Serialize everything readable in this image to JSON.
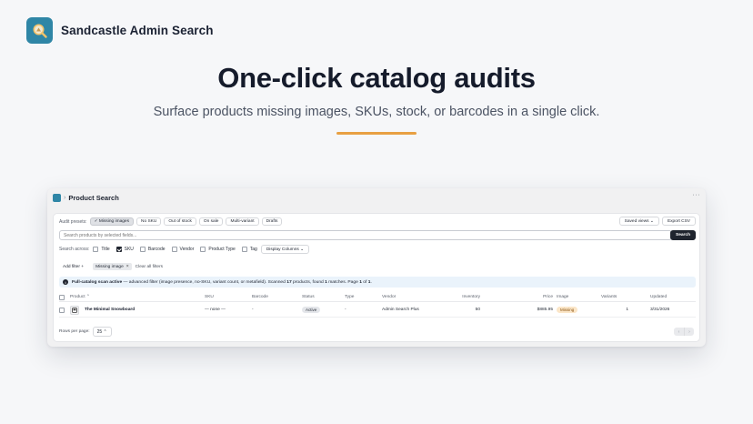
{
  "brand": {
    "name": "Sandcastle Admin Search",
    "logo_icon": "magnifier-icon",
    "logo_color": "#2f86a6"
  },
  "hero": {
    "title": "One-click catalog audits",
    "subtitle": "Surface products missing images, SKUs, stock, or barcodes in a single click.",
    "accent": "#e8a043"
  },
  "app": {
    "breadcrumb_sep": "›",
    "title": "Product Search",
    "more": "···",
    "audit": {
      "label": "Audit presets:",
      "presets": [
        {
          "label": "✓ Missing images",
          "active": true
        },
        {
          "label": "No SKU"
        },
        {
          "label": "Out of stock"
        },
        {
          "label": "On sale"
        },
        {
          "label": "Multi-variant"
        },
        {
          "label": "Drafts"
        }
      ],
      "saved_views": "Saved views ⌄",
      "export": "Export CSV"
    },
    "search": {
      "placeholder": "Search products by selected fields...",
      "button": "Search"
    },
    "search_across": {
      "label": "Search across:",
      "fields": [
        {
          "label": "Title",
          "checked": false
        },
        {
          "label": "SKU",
          "checked": true
        },
        {
          "label": "Barcode",
          "checked": false
        },
        {
          "label": "Vendor",
          "checked": false
        },
        {
          "label": "Product Type",
          "checked": false
        },
        {
          "label": "Tag",
          "checked": false
        }
      ],
      "display_columns": "Display Columns ⌄"
    },
    "filters": {
      "add": "Add filter +",
      "chip": "Missing image",
      "chip_close": "×",
      "clear": "Clear all filters"
    },
    "banner": {
      "icon": "i",
      "bold": "Full-catalog scan active",
      "text1": " — advanced filter (image presence, no-SKU, variant count, or metafield). Scanned ",
      "scanned": "17",
      "text2": " products, found ",
      "found": "1",
      "text3": " matches. Page ",
      "page": "1",
      "text4": " of ",
      "pages": "1",
      "text5": "."
    },
    "table": {
      "headers": {
        "product": "Product ⌃",
        "sku": "SKU",
        "barcode": "Barcode",
        "status": "Status",
        "type": "Type",
        "vendor": "Vendor",
        "inventory": "Inventory",
        "price": "Price",
        "image": "Image",
        "variants": "Variants",
        "updated": "Updated"
      },
      "rows": [
        {
          "product": "The Minimal Snowboard",
          "sku": "— none —",
          "barcode": "-",
          "status": "Active",
          "type": "-",
          "vendor": "Admin Search Plus",
          "inventory": "50",
          "price": "$885.95",
          "image": "Missing",
          "variants": "1",
          "updated": "3/31/2026"
        }
      ]
    },
    "footer": {
      "rows_per_page_label": "Rows per page:",
      "rows_per_page": "25 ⌃",
      "prev": "‹",
      "next": "›"
    }
  }
}
